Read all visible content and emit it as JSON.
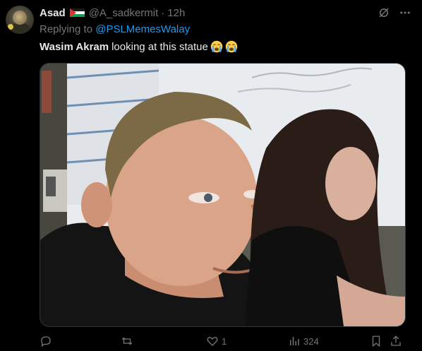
{
  "author": {
    "display_name": "Asad",
    "handle": "@A_sadkermit",
    "separator": "·",
    "timestamp": "12h",
    "flag_icon": "palestine-flag-icon"
  },
  "reply": {
    "prefix": "Replying to",
    "mention": "@PSLMemesWalay"
  },
  "tweet": {
    "bold_part": "Wasim Akram",
    "text_part": "looking at this statue",
    "emojis": [
      "loudly-crying-face",
      "loudly-crying-face"
    ]
  },
  "media": {
    "alt_description_icon": "photo-classroom-boy-holding-breath"
  },
  "actions": {
    "reply_count": "",
    "repost_count": "",
    "like_count": "1",
    "views_count": "324"
  },
  "colors": {
    "background": "#000000",
    "text_primary": "#e7e9ea",
    "text_secondary": "#71767b",
    "link": "#1d9bf0"
  },
  "icons": {
    "top": [
      "grok-icon",
      "more-icon"
    ],
    "bottom": [
      "reply-icon",
      "repost-icon",
      "like-icon",
      "views-icon",
      "bookmark-icon",
      "share-icon"
    ]
  }
}
